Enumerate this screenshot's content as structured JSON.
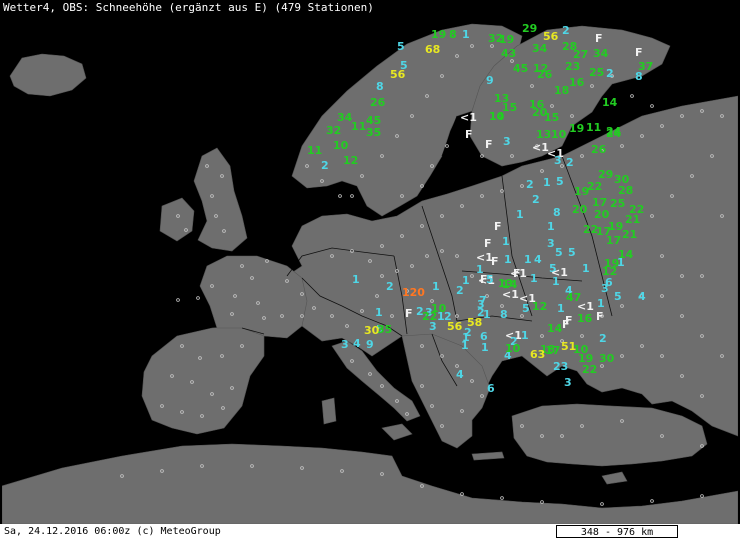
{
  "header": {
    "title": "Wetter4, OBS: Schneehöhe (ergänzt aus E) (479 Stationen)"
  },
  "footer": {
    "datetime": "Sa, 24.12.2016 06:00z (c) MeteoGroup",
    "scale": "348 - 976 km"
  },
  "map": {
    "colors": {
      "sea": "#000000",
      "land": "#6e6e6e",
      "border": "#000000",
      "station": "#c8c8c8",
      "cyan": "#4fd6e6",
      "green": "#22cc22",
      "yellow": "#e8e822",
      "white": "#f2f2f2",
      "orange": "#ff7722"
    },
    "observations": [
      {
        "t": "19",
        "c": "green"
      },
      {
        "t": "8",
        "c": "green"
      },
      {
        "t": "1",
        "c": "cyan"
      },
      {
        "t": "5",
        "c": "cyan"
      },
      {
        "t": "68",
        "c": "yellow"
      },
      {
        "t": "5",
        "c": "cyan"
      },
      {
        "t": "56",
        "c": "yellow"
      },
      {
        "t": "8",
        "c": "cyan"
      },
      {
        "t": "26",
        "c": "green"
      },
      {
        "t": "32",
        "c": "green"
      },
      {
        "t": "19",
        "c": "green"
      },
      {
        "t": "29",
        "c": "green"
      },
      {
        "t": "2",
        "c": "cyan"
      },
      {
        "t": "56",
        "c": "yellow"
      },
      {
        "t": "F",
        "c": "white"
      },
      {
        "t": "28",
        "c": "green"
      },
      {
        "t": "34",
        "c": "green"
      },
      {
        "t": "43",
        "c": "green"
      },
      {
        "t": "34",
        "c": "green"
      },
      {
        "t": "27",
        "c": "green"
      },
      {
        "t": "F",
        "c": "white"
      },
      {
        "t": "37",
        "c": "green"
      },
      {
        "t": "12",
        "c": "green"
      },
      {
        "t": "45",
        "c": "green"
      },
      {
        "t": "2",
        "c": "cyan"
      },
      {
        "t": "8",
        "c": "cyan"
      },
      {
        "t": "23",
        "c": "green"
      },
      {
        "t": "25",
        "c": "green"
      },
      {
        "t": "14",
        "c": "green"
      },
      {
        "t": "9",
        "c": "cyan"
      },
      {
        "t": "16",
        "c": "green"
      },
      {
        "t": "26",
        "c": "green"
      },
      {
        "t": "18",
        "c": "green"
      },
      {
        "t": "13",
        "c": "green"
      },
      {
        "t": "15",
        "c": "green"
      },
      {
        "t": "14",
        "c": "green"
      },
      {
        "t": "16",
        "c": "green"
      },
      {
        "t": "20",
        "c": "green"
      },
      {
        "t": "15",
        "c": "green"
      },
      {
        "t": "24",
        "c": "green"
      },
      {
        "t": "34",
        "c": "green"
      },
      {
        "t": "45",
        "c": "green"
      },
      {
        "t": "32",
        "c": "green"
      },
      {
        "t": "11",
        "c": "green"
      },
      {
        "t": "35",
        "c": "green"
      },
      {
        "t": "10",
        "c": "green"
      },
      {
        "t": "11",
        "c": "green"
      },
      {
        "t": "12",
        "c": "green"
      },
      {
        "t": "2",
        "c": "cyan"
      },
      {
        "t": "<1",
        "c": "white"
      },
      {
        "t": "F",
        "c": "white"
      },
      {
        "t": "10",
        "c": "green"
      },
      {
        "t": "13",
        "c": "green"
      },
      {
        "t": "10",
        "c": "green"
      },
      {
        "t": "19",
        "c": "green"
      },
      {
        "t": "11",
        "c": "green"
      },
      {
        "t": "F",
        "c": "white"
      },
      {
        "t": "3",
        "c": "cyan"
      },
      {
        "t": "<1",
        "c": "white"
      },
      {
        "t": "<1",
        "c": "white"
      },
      {
        "t": "3",
        "c": "cyan"
      },
      {
        "t": "2",
        "c": "cyan"
      },
      {
        "t": "26",
        "c": "green"
      },
      {
        "t": "24",
        "c": "green"
      },
      {
        "t": "29",
        "c": "green"
      },
      {
        "t": "30",
        "c": "green"
      },
      {
        "t": "28",
        "c": "green"
      },
      {
        "t": "2",
        "c": "cyan"
      },
      {
        "t": "1",
        "c": "cyan"
      },
      {
        "t": "5",
        "c": "cyan"
      },
      {
        "t": "19",
        "c": "green"
      },
      {
        "t": "22",
        "c": "green"
      },
      {
        "t": "2",
        "c": "cyan"
      },
      {
        "t": "8",
        "c": "cyan"
      },
      {
        "t": "17",
        "c": "green"
      },
      {
        "t": "25",
        "c": "green"
      },
      {
        "t": "22",
        "c": "green"
      },
      {
        "t": "20",
        "c": "green"
      },
      {
        "t": "20",
        "c": "green"
      },
      {
        "t": "21",
        "c": "green"
      },
      {
        "t": "F",
        "c": "white"
      },
      {
        "t": "1",
        "c": "cyan"
      },
      {
        "t": "1",
        "c": "cyan"
      },
      {
        "t": "3",
        "c": "cyan"
      },
      {
        "t": "22",
        "c": "green"
      },
      {
        "t": "17",
        "c": "green"
      },
      {
        "t": "19",
        "c": "green"
      },
      {
        "t": "17",
        "c": "green"
      },
      {
        "t": "21",
        "c": "green"
      },
      {
        "t": "F",
        "c": "white"
      },
      {
        "t": "<1",
        "c": "white"
      },
      {
        "t": "1",
        "c": "cyan"
      },
      {
        "t": "5",
        "c": "cyan"
      },
      {
        "t": "5",
        "c": "cyan"
      },
      {
        "t": "14",
        "c": "green"
      },
      {
        "t": "F",
        "c": "white"
      },
      {
        "t": "F",
        "c": "white"
      },
      {
        "t": "<1",
        "c": "white"
      },
      {
        "t": "1",
        "c": "cyan"
      },
      {
        "t": "4",
        "c": "cyan"
      },
      {
        "t": "5",
        "c": "cyan"
      },
      {
        "t": "12",
        "c": "green"
      },
      {
        "t": "19",
        "c": "green"
      },
      {
        "t": "1",
        "c": "cyan"
      },
      {
        "t": "1",
        "c": "cyan"
      },
      {
        "t": "1",
        "c": "cyan"
      },
      {
        "t": "F",
        "c": "white"
      },
      {
        "t": "<1",
        "c": "white"
      },
      {
        "t": "1",
        "c": "cyan"
      },
      {
        "t": "<1",
        "c": "white"
      },
      {
        "t": "1",
        "c": "cyan"
      },
      {
        "t": "6",
        "c": "cyan"
      },
      {
        "t": "14",
        "c": "green"
      },
      {
        "t": "5",
        "c": "cyan"
      },
      {
        "t": "13",
        "c": "green"
      },
      {
        "t": "1",
        "c": "cyan"
      },
      {
        "t": "1",
        "c": "cyan"
      },
      {
        "t": "4",
        "c": "cyan"
      },
      {
        "t": "47",
        "c": "green"
      },
      {
        "t": "3",
        "c": "cyan"
      },
      {
        "t": "1",
        "c": "cyan"
      },
      {
        "t": "2",
        "c": "cyan"
      },
      {
        "t": "1",
        "c": "cyan"
      },
      {
        "t": "120",
        "c": "orange"
      },
      {
        "t": "10",
        "c": "green"
      },
      {
        "t": "2",
        "c": "cyan"
      },
      {
        "t": "1",
        "c": "cyan"
      },
      {
        "t": "2",
        "c": "cyan"
      },
      {
        "t": "1",
        "c": "cyan"
      },
      {
        "t": "7",
        "c": "cyan"
      },
      {
        "t": "3",
        "c": "cyan"
      },
      {
        "t": "2",
        "c": "cyan"
      },
      {
        "t": "2",
        "c": "cyan"
      },
      {
        "t": "<1",
        "c": "white"
      },
      {
        "t": "<1",
        "c": "white"
      },
      {
        "t": "5",
        "c": "cyan"
      },
      {
        "t": "1",
        "c": "cyan"
      },
      {
        "t": "<1",
        "c": "white"
      },
      {
        "t": "5",
        "c": "cyan"
      },
      {
        "t": "4",
        "c": "cyan"
      },
      {
        "t": "1",
        "c": "cyan"
      },
      {
        "t": "F",
        "c": "white"
      },
      {
        "t": "3",
        "c": "cyan"
      },
      {
        "t": "3",
        "c": "cyan"
      },
      {
        "t": "58",
        "c": "yellow"
      },
      {
        "t": "12",
        "c": "green"
      },
      {
        "t": "2",
        "c": "cyan"
      },
      {
        "t": "F",
        "c": "white"
      },
      {
        "t": "6",
        "c": "cyan"
      },
      {
        "t": "1",
        "c": "cyan"
      },
      {
        "t": "2",
        "c": "cyan"
      },
      {
        "t": "1",
        "c": "cyan"
      },
      {
        "t": "1",
        "c": "cyan"
      },
      {
        "t": "14",
        "c": "green"
      },
      {
        "t": "F",
        "c": "white"
      },
      {
        "t": "F",
        "c": "white"
      },
      {
        "t": "51",
        "c": "yellow"
      },
      {
        "t": "4",
        "c": "cyan"
      },
      {
        "t": "<1",
        "c": "white"
      },
      {
        "t": "2",
        "c": "cyan"
      },
      {
        "t": "8",
        "c": "cyan"
      },
      {
        "t": "16",
        "c": "green"
      },
      {
        "t": "22",
        "c": "green"
      },
      {
        "t": "56",
        "c": "yellow"
      },
      {
        "t": "5",
        "c": "cyan"
      },
      {
        "t": "3",
        "c": "cyan"
      },
      {
        "t": "4",
        "c": "cyan"
      },
      {
        "t": "9",
        "c": "cyan"
      },
      {
        "t": "35",
        "c": "green"
      },
      {
        "t": "30",
        "c": "yellow"
      },
      {
        "t": "1",
        "c": "cyan"
      },
      {
        "t": "10",
        "c": "green"
      },
      {
        "t": "17",
        "c": "green"
      },
      {
        "t": "18",
        "c": "green"
      },
      {
        "t": "23",
        "c": "cyan"
      },
      {
        "t": "10",
        "c": "green"
      },
      {
        "t": "19",
        "c": "green"
      },
      {
        "t": "30",
        "c": "green"
      },
      {
        "t": "3",
        "c": "cyan"
      },
      {
        "t": "63",
        "c": "yellow"
      },
      {
        "t": "1",
        "c": "cyan"
      },
      {
        "t": "22",
        "c": "green"
      },
      {
        "t": "4",
        "c": "cyan"
      },
      {
        "t": "6",
        "c": "cyan"
      }
    ]
  }
}
